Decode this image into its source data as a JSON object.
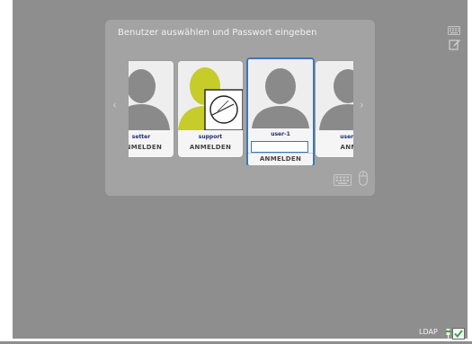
{
  "panel": {
    "title": "Benutzer auswählen und Passwort eingeben",
    "prev_arrow": "‹",
    "next_arrow": "›"
  },
  "users": [
    {
      "name": "setter",
      "login_label": "ANMELDEN",
      "avatar": "person-silhouette-icon"
    },
    {
      "name": "support",
      "login_label": "ANMELDEN",
      "avatar": "support-avatar-with-badge"
    },
    {
      "name": "user-1",
      "login_label": "ANMELDEN",
      "avatar": "person-silhouette-icon",
      "selected": true,
      "password_value": ""
    },
    {
      "name": "useradm",
      "login_label": "ANMEL",
      "avatar": "person-silhouette-icon"
    }
  ],
  "status": {
    "ldap_label": "LDAP"
  },
  "colors": {
    "background": "#8e8e8e",
    "panel": "#a3a3a3",
    "selected_border": "#3c78b4",
    "username": "#1f2d6e",
    "support_accent": "#c6cc2a",
    "ldap_ok": "#3aa83a"
  }
}
